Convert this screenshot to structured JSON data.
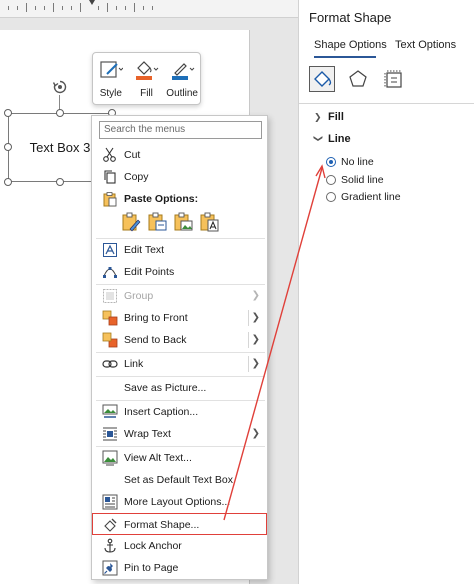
{
  "document": {
    "textbox_text": "Text Box 3"
  },
  "mini_toolbar": {
    "style_label": "Style",
    "fill_label": "Fill",
    "outline_label": "Outline"
  },
  "context_menu": {
    "search_placeholder": "Search the menus",
    "cut": "Cut",
    "copy": "Copy",
    "paste_options": "Paste Options:",
    "edit_text": "Edit Text",
    "edit_points": "Edit Points",
    "group": "Group",
    "bring_to_front": "Bring to Front",
    "send_to_back": "Send to Back",
    "link": "Link",
    "save_as_picture": "Save as Picture...",
    "insert_caption": "Insert Caption...",
    "wrap_text": "Wrap Text",
    "view_alt_text": "View Alt Text...",
    "set_default": "Set as Default Text Box",
    "more_layout": "More Layout Options...",
    "format_shape": "Format Shape...",
    "lock_anchor": "Lock Anchor",
    "pin_to_page": "Pin to Page"
  },
  "panel": {
    "title": "Format Shape",
    "tab_shape": "Shape Options",
    "tab_text": "Text Options",
    "fill_section": "Fill",
    "line_section": "Line",
    "no_line": "No line",
    "solid_line": "Solid line",
    "gradient_line": "Gradient line"
  },
  "colors": {
    "accent": "#2b5797",
    "annotation_red": "#e0403a",
    "fill_orange": "#e8632a",
    "outline_blue": "#1e6fb8"
  }
}
